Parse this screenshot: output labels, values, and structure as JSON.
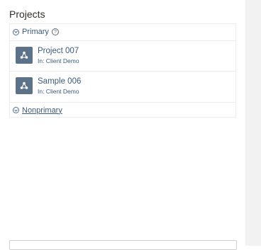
{
  "panel": {
    "title": "Projects"
  },
  "groups": {
    "primary": {
      "label": "Primary",
      "expanded": true,
      "help_icon": "help-circle-icon"
    },
    "nonprimary": {
      "label": "Nonprimary",
      "expanded": true
    }
  },
  "projects": [
    {
      "name": "Project 007",
      "subtitle": "In: Client Demo",
      "icon": "project-network-icon"
    },
    {
      "name": "Sample 006",
      "subtitle": "In: Client Demo",
      "icon": "project-network-icon"
    }
  ],
  "colors": {
    "link": "#3a5a78",
    "tile": "#5b7288",
    "divider": "#ececec"
  }
}
